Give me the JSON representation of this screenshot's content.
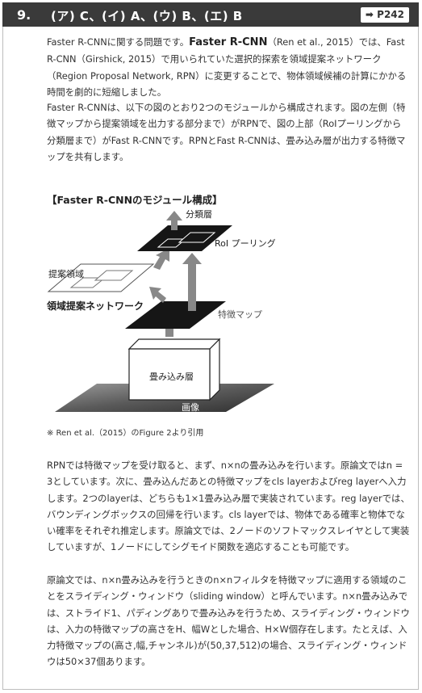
{
  "header": {
    "number": "9.",
    "answer": "(ア) C、(イ) A、(ウ) B、(エ) B",
    "page_ref": "➡ P242"
  },
  "intro": {
    "p1_a": "Faster R-CNNに関する問題です。",
    "p1_b": "Faster R-CNN",
    "p1_c": "（Ren et al., 2015）では、Fast R-CNN（Girshick, 2015）で用いられていた選択的探索を領域提案ネットワーク（Region Proposal Network, RPN）に変更することで、物体領域候補の計算にかかる時間を劇的に短縮しました。",
    "p2": "Faster R-CNNは、以下の図のとおり2つのモジュールから構成されます。図の左側（特徴マップから提案領域を出力する部分まで）がRPNで、図の上部（RoIプーリングから分類層まで）がFast R-CNNです。RPNとFast R-CNNは、畳み込み層が出力する特徴マップを共有します。"
  },
  "figure": {
    "title": "【Faster R-CNNのモジュール構成】",
    "labels": {
      "classifier": "分類層",
      "roi_pooling": "RoI プーリング",
      "proposals": "提案領域",
      "rpn": "領域提案ネットワーク",
      "feature_map": "特徴マップ",
      "conv_layers": "畳み込み層",
      "image": "画像"
    },
    "note": "※ Ren et al.（2015）のFigure 2より引用"
  },
  "body": {
    "p3": "RPNでは特徴マップを受け取ると、まず、n×nの畳み込みを行います。原論文ではn = 3としています。次に、畳み込んだあとの特徴マップをcls layerおよびreg layerへ入力します。2つのlayerは、どちらも1×1畳み込み層で実装されています。reg layerでは、バウンディングボックスの回帰を行います。cls layerでは、物体である確率と物体でない確率をそれぞれ推定します。原論文では、2ノードのソフトマックスレイヤとして実装していますが、1ノードにしてシグモイド関数を適応することも可能です。",
    "p4": "原論文では、n×n畳み込みを行うときのn×nフィルタを特徴マップに適用する領域のことをスライディング・ウィンドウ（sliding window）と呼んでいます。n×n畳み込みでは、ストライド1、パディングありで畳み込みを行うため、スライディング・ウィンドウは、入力の特徴マップの高さをH、幅Wとした場合、H×W個存在します。たとえば、入力特徴マップの(高さ,幅,チャンネル)が(50,37,512)の場合、スライディング・ウィンドウは50×37個あります。"
  }
}
